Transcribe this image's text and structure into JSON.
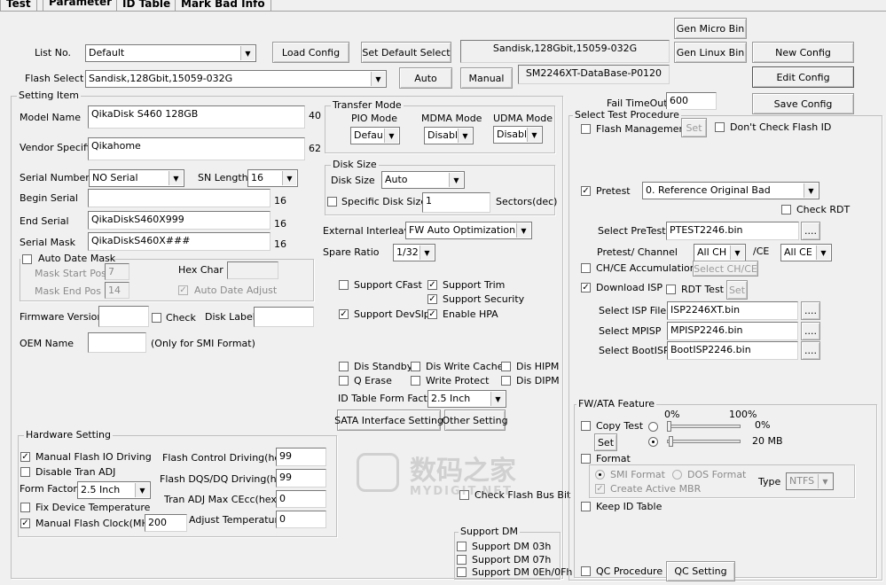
{
  "tabs": [
    "Test",
    "Parameter",
    "ID Table",
    "Mark Bad Info"
  ],
  "top": {
    "list_no_label": "List No.",
    "list_no_value": "Default",
    "load_config": "Load Config",
    "set_default_select": "Set Default Select",
    "flash_info": "Sandisk,128Gbit,15059-032G",
    "gen_micro_bin": "Gen Micro Bin",
    "gen_linux_bin": "Gen Linux Bin",
    "new_config": "New Config",
    "flash_select_label": "Flash Select",
    "flash_select_value": "Sandisk,128Gbit,15059-032G",
    "auto": "Auto",
    "manual": "Manual",
    "database": "SM2246XT-DataBase-P0120",
    "edit_config": "Edit Config",
    "fail_timeout_label": "Fail TimeOut",
    "fail_timeout_value": "600",
    "save_config": "Save Config"
  },
  "setting": {
    "title": "Setting Item",
    "model_name_label": "Model Name",
    "model_name_value": "QikaDisk S460 128GB",
    "model_name_len": "40",
    "vendor_label": "Vendor Specific",
    "vendor_value": "Qikahome",
    "vendor_len": "62",
    "serial_number_label": "Serial Number",
    "serial_number_value": "NO Serial",
    "sn_length_label": "SN Length",
    "sn_length_value": "16",
    "begin_serial_label": "Begin Serial",
    "begin_serial_value": "",
    "begin_serial_len": "16",
    "end_serial_label": "End Serial",
    "end_serial_value": "QikaDiskS460X999",
    "end_serial_len": "16",
    "serial_mask_label": "Serial Mask",
    "serial_mask_value": "QikaDiskS460X###",
    "serial_mask_len": "16",
    "auto_date_mask": "Auto Date Mask",
    "mask_start_pos_label": "Mask Start Pos",
    "mask_start_pos_value": "7",
    "mask_end_pos_label": "Mask End Pos",
    "mask_end_pos_value": "14",
    "hex_char_label": "Hex Char",
    "auto_date_adjust": "Auto Date Adjust",
    "firmware_version_label": "Firmware Version",
    "check_label": "Check",
    "disk_label_label": "Disk Label",
    "oem_name_label": "OEM Name",
    "oem_note": "(Only for SMI Format)"
  },
  "transfer": {
    "title": "Transfer Mode",
    "pio_label": "PIO Mode",
    "pio_value": "Default",
    "mdma_label": "MDMA Mode",
    "mdma_value": "Disable",
    "udma_label": "UDMA Mode",
    "udma_value": "Disable"
  },
  "disk_size": {
    "title": "Disk Size",
    "label": "Disk Size",
    "value": "Auto",
    "specific_label": "Specific Disk Size",
    "specific_value": "1",
    "unit": "Sectors(dec)"
  },
  "mid": {
    "ext_interleave_label": "External Interleave",
    "ext_interleave_value": "FW Auto Optimization",
    "spare_ratio_label": "Spare Ratio",
    "spare_ratio_value": "1/32",
    "support_cfast": "Support CFast",
    "support_trim": "Support Trim",
    "support_security": "Support Security",
    "support_devslp": "Support DevSlp",
    "enable_hpa": "Enable HPA",
    "dis_standby": "Dis Standby",
    "dis_write_cache": "Dis Write Cache",
    "dis_hipm": "Dis HIPM",
    "q_erase": "Q Erase",
    "write_protect": "Write Protect",
    "dis_dipm": "Dis DIPM",
    "id_table_form_factor_label": "ID Table Form Factor",
    "id_table_form_factor_value": "2.5 Inch",
    "sata_interface_setting": "SATA Interface Setting",
    "other_setting": "Other Setting",
    "check_flash_bus_bit": "Check Flash Bus Bit"
  },
  "hardware": {
    "title": "Hardware Setting",
    "manual_flash_io": "Manual Flash IO Driving",
    "flash_control_label": "Flash Control Driving(hex)",
    "flash_control_value": "99",
    "disable_tran_adj": "Disable Tran ADJ",
    "flash_dqs_label": "Flash DQS/DQ Driving(hex)",
    "flash_dqs_value": "99",
    "form_factor_label": "Form Factor",
    "form_factor_value": "2.5 Inch",
    "tran_adj_label": "Tran ADJ Max CEcc(hex)",
    "tran_adj_value": "0",
    "fix_device_temp": "Fix Device Temperature",
    "manual_flash_clock": "Manual Flash Clock(MHz)",
    "flash_clock_value": "200",
    "adjust_temp_label": "Adjust Temperature",
    "adjust_temp_value": "0"
  },
  "support_dm": {
    "title": "Support DM",
    "dm03": "Support DM 03h",
    "dm07": "Support DM 07h",
    "dm0e": "Support DM 0Eh/0Fh"
  },
  "procedure": {
    "title": "Select Test Procedure",
    "flash_management": "Flash Management",
    "set": "Set",
    "dont_check_flash_id": "Don't Check Flash ID",
    "pretest_label": "Pretest",
    "pretest_value": "0. Reference Original Bad",
    "check_rdt": "Check RDT",
    "select_pretest_label": "Select PreTest",
    "select_pretest_value": "PTEST2246.bin",
    "browse": "....",
    "pretest_channel_label": "Pretest/ Channel",
    "channel_value": "All CH",
    "ce_label": "/CE",
    "ce_value": "All CE",
    "chce_accumulation": "CH/CE Accumulation",
    "select_chce": "Select CH/CE",
    "download_isp": "Download ISP",
    "rdt_test": "RDT Test",
    "select_isp_label": "Select ISP File",
    "select_isp_value": "ISP2246XT.bin",
    "select_mpisp_label": "Select MPISP",
    "select_mpisp_value": "MPISP2246.bin",
    "select_bootisp_label": "Select BootISP",
    "select_bootisp_value": "BootISP2246.bin"
  },
  "fw_ata": {
    "title": "FW/ATA Feature",
    "copy_test": "Copy Test",
    "set": "Set",
    "pct_0": "0%",
    "pct_100": "100%",
    "slider1_value": "0%",
    "slider1_level": 0,
    "slider2_value": "20 MB",
    "slider2_level": 0.02,
    "format": "Format",
    "smi_format": "SMI Format",
    "dos_format": "DOS Format",
    "create_active_mbr": "Create Active MBR",
    "type_label": "Type",
    "type_value": "NTFS",
    "keep_id_table": "Keep ID Table",
    "qc_procedure": "QC Procedure",
    "qc_setting": "QC Setting"
  },
  "watermark": {
    "cn": "数码之家",
    "en": "MYDIGIT.NET"
  }
}
